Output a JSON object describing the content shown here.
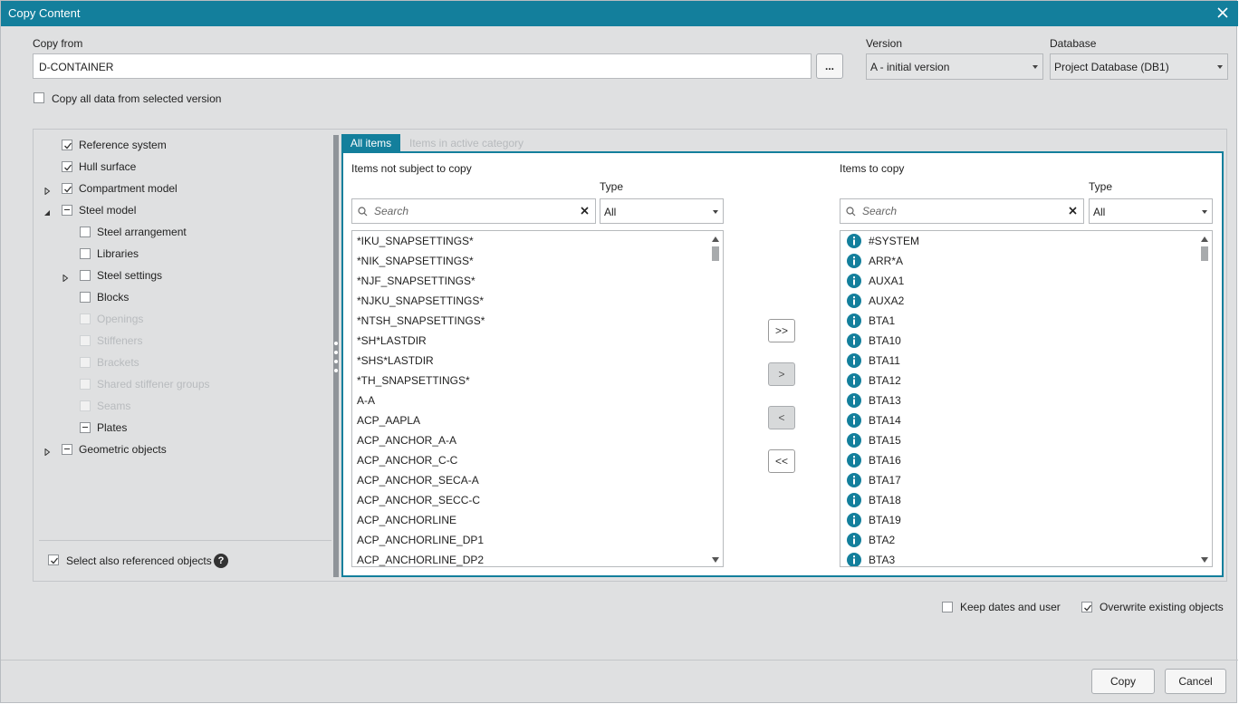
{
  "window": {
    "title": "Copy Content"
  },
  "copy_from": {
    "label": "Copy from",
    "value": "D-CONTAINER",
    "browse_label": "..."
  },
  "version": {
    "label": "Version",
    "selected": "A - initial version"
  },
  "database": {
    "label": "Database",
    "selected": "Project Database (DB1)"
  },
  "copy_all": {
    "label": "Copy all data from selected version",
    "checked": false
  },
  "tree": [
    {
      "label": "Reference system",
      "state": "checked",
      "expander": "none",
      "level": 0,
      "disabled": false
    },
    {
      "label": "Hull surface",
      "state": "checked",
      "expander": "none",
      "level": 0,
      "disabled": false
    },
    {
      "label": "Compartment model",
      "state": "checked",
      "expander": "collapsed",
      "level": 0,
      "disabled": false
    },
    {
      "label": "Steel model",
      "state": "partial",
      "expander": "expanded",
      "level": 0,
      "disabled": false
    },
    {
      "label": "Steel arrangement",
      "state": "unchecked",
      "expander": "none",
      "level": 1,
      "disabled": false
    },
    {
      "label": "Libraries",
      "state": "unchecked",
      "expander": "none",
      "level": 1,
      "disabled": false
    },
    {
      "label": "Steel settings",
      "state": "unchecked",
      "expander": "collapsed",
      "level": 1,
      "disabled": false
    },
    {
      "label": "Blocks",
      "state": "unchecked",
      "expander": "none",
      "level": 1,
      "disabled": false
    },
    {
      "label": "Openings",
      "state": "unchecked",
      "expander": "none",
      "level": 1,
      "disabled": true
    },
    {
      "label": "Stiffeners",
      "state": "unchecked",
      "expander": "none",
      "level": 1,
      "disabled": true
    },
    {
      "label": "Brackets",
      "state": "unchecked",
      "expander": "none",
      "level": 1,
      "disabled": true
    },
    {
      "label": "Shared stiffener groups",
      "state": "unchecked",
      "expander": "none",
      "level": 1,
      "disabled": true
    },
    {
      "label": "Seams",
      "state": "unchecked",
      "expander": "none",
      "level": 1,
      "disabled": true
    },
    {
      "label": "Plates",
      "state": "partial",
      "expander": "none",
      "level": 1,
      "disabled": false
    },
    {
      "label": "Geometric objects",
      "state": "partial",
      "expander": "collapsed",
      "level": 0,
      "disabled": false
    }
  ],
  "select_referenced": {
    "label": "Select also referenced objects",
    "checked": true,
    "help_icon": "?"
  },
  "tabs": {
    "all_items": "All items",
    "active_category": "Items in active category"
  },
  "left_list": {
    "title": "Items not subject to copy",
    "type_label": "Type",
    "type_selected": "All",
    "search_placeholder": "Search",
    "items": [
      "*IKU_SNAPSETTINGS*",
      "*NIK_SNAPSETTINGS*",
      "*NJF_SNAPSETTINGS*",
      "*NJKU_SNAPSETTINGS*",
      "*NTSH_SNAPSETTINGS*",
      "*SH*LASTDIR",
      "*SHS*LASTDIR",
      "*TH_SNAPSETTINGS*",
      "A-A",
      "ACP_AAPLA",
      "ACP_ANCHOR_A-A",
      "ACP_ANCHOR_C-C",
      "ACP_ANCHOR_SECA-A",
      "ACP_ANCHOR_SECC-C",
      "ACP_ANCHORLINE",
      "ACP_ANCHORLINE_DP1",
      "ACP_ANCHORLINE_DP2"
    ]
  },
  "right_list": {
    "title": "Items to copy",
    "type_label": "Type",
    "type_selected": "All",
    "search_placeholder": "Search",
    "items": [
      "#SYSTEM",
      "ARR*A",
      "AUXA1",
      "AUXA2",
      "BTA1",
      "BTA10",
      "BTA11",
      "BTA12",
      "BTA13",
      "BTA14",
      "BTA15",
      "BTA16",
      "BTA17",
      "BTA18",
      "BTA19",
      "BTA2",
      "BTA3"
    ]
  },
  "move_buttons": {
    "add_all": ">>",
    "add": ">",
    "remove": "<",
    "remove_all": "<<"
  },
  "keep_dates": {
    "label": "Keep dates and user",
    "checked": false
  },
  "overwrite": {
    "label": "Overwrite existing objects",
    "checked": true
  },
  "actions": {
    "copy": "Copy",
    "cancel": "Cancel"
  },
  "colors": {
    "accent": "#137f9c",
    "info_icon": "#137f9c",
    "dialog_bg": "#dfe0e1"
  }
}
